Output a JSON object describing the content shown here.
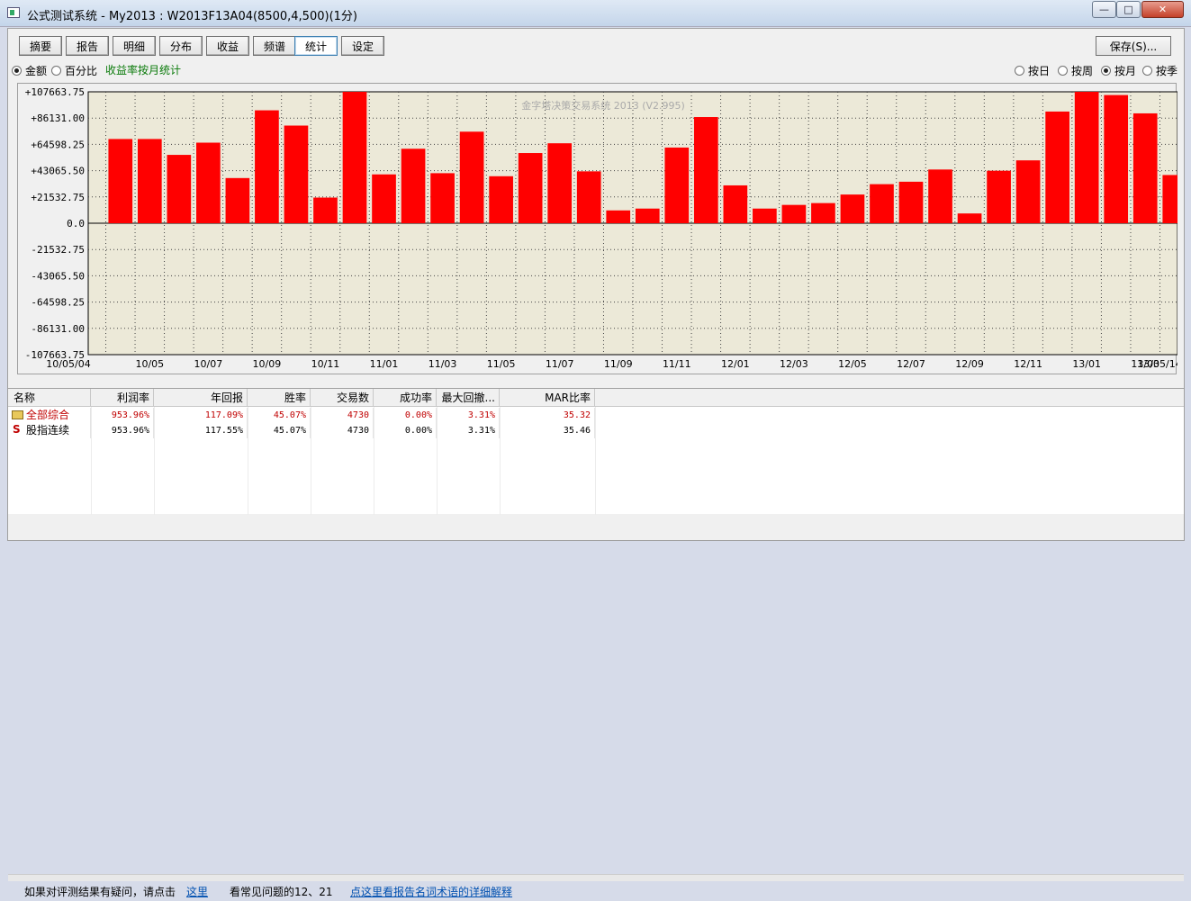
{
  "window": {
    "title": "公式测试系统 - My2013 : W2013F13A04(8500,4,500)(1分)",
    "minimize": "—",
    "maximize": "□",
    "close": "✕"
  },
  "tabs": [
    "摘要",
    "报告",
    "明细",
    "分布",
    "收益",
    "频谱",
    "统计",
    "设定"
  ],
  "active_tab": "统计",
  "save_label": "保存(S)...",
  "mode": {
    "options": [
      "金额",
      "百分比"
    ],
    "selected": "金额",
    "subtitle": "收益率按月统计"
  },
  "period": {
    "options": [
      "按日",
      "按周",
      "按月",
      "按季"
    ],
    "selected": "按月"
  },
  "chart_data": {
    "type": "bar",
    "watermark": "金字塔决策交易系统 2013 (V2.995)",
    "ylim": [
      -107663.75,
      107663.75
    ],
    "y_ticks": [
      "+107663.75",
      "+86131.00",
      "+64598.25",
      "+43065.50",
      "+21532.75",
      "0.0",
      "-21532.75",
      "-43065.50",
      "-64598.25",
      "-86131.00",
      "-107663.75"
    ],
    "x_tick_labels": [
      "10/05/04",
      "10/05",
      "10/07",
      "10/09",
      "10/11",
      "11/01",
      "11/03",
      "11/05",
      "11/07",
      "11/09",
      "11/11",
      "12/01",
      "12/03",
      "12/05",
      "12/07",
      "12/09",
      "12/11",
      "13/01",
      "13/03",
      "13/05/14"
    ],
    "categories": [
      "10/05",
      "10/06",
      "10/07",
      "10/08",
      "10/09",
      "10/10",
      "10/11",
      "10/12",
      "11/01",
      "11/02",
      "11/03",
      "11/04",
      "11/05",
      "11/06",
      "11/07",
      "11/08",
      "11/09",
      "11/10",
      "11/11",
      "11/12",
      "12/01",
      "12/02",
      "12/03",
      "12/04",
      "12/05",
      "12/06",
      "12/07",
      "12/08",
      "12/09",
      "12/10",
      "12/11",
      "12/12",
      "13/01",
      "13/02",
      "13/03",
      "13/04",
      "13/05"
    ],
    "values": [
      69000,
      69000,
      56000,
      66000,
      37000,
      92500,
      80000,
      21000,
      107663,
      40000,
      61000,
      41000,
      75000,
      38500,
      57500,
      65500,
      42500,
      10500,
      12000,
      62000,
      87000,
      31000,
      12000,
      15000,
      16500,
      23500,
      32000,
      34000,
      44000,
      8000,
      43000,
      51500,
      91500,
      107663,
      105000,
      90000,
      39500
    ],
    "bar_color": "#ff0000"
  },
  "grid": {
    "columns": [
      "名称",
      "利润率",
      "年回报",
      "胜率",
      "交易数",
      "成功率",
      "最大回撤...",
      "MAR比率"
    ],
    "rows": [
      {
        "icon": "folder-icon",
        "cells": [
          "全部综合",
          "953.96%",
          "117.09%",
          "45.07%",
          "4730",
          "0.00%",
          "3.31%",
          "35.32"
        ],
        "color": "#c00000"
      },
      {
        "icon": "s-icon",
        "cells": [
          "股指连续",
          "953.96%",
          "117.55%",
          "45.07%",
          "4730",
          "0.00%",
          "3.31%",
          "35.46"
        ],
        "color": "#000000"
      }
    ]
  },
  "footer": {
    "text1": "如果对评测结果有疑问，请点击",
    "link1": "这里",
    "text2": "看常见问题的12、21",
    "link2": "点这里看报告名词术语的详细解释"
  }
}
